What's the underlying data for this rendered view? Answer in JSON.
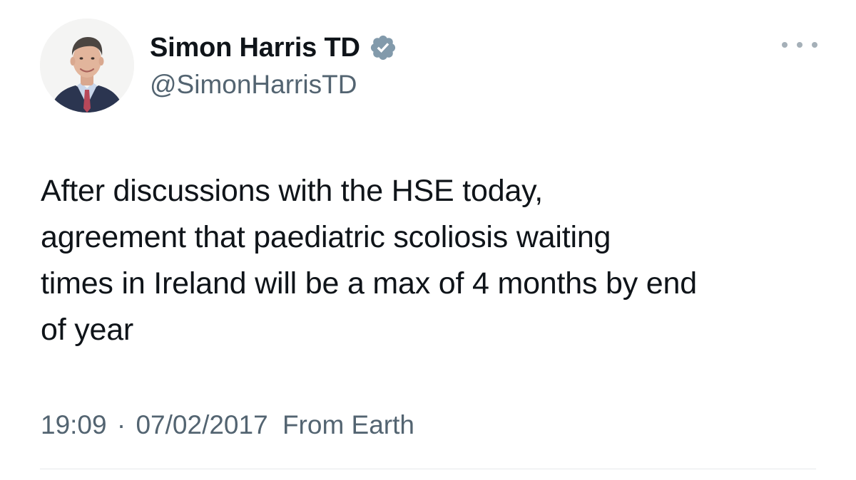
{
  "tweet": {
    "author": {
      "display_name": "Simon Harris TD",
      "handle": "@SimonHarrisTD",
      "verified": true,
      "avatar_icon": "profile-photo"
    },
    "text": "After discussions with the HSE today,\nagreement that paediatric scoliosis waiting\ntimes in Ireland will be a max of 4 months by end\nof year",
    "meta": {
      "time": "19:09",
      "separator": "·",
      "date": "07/02/2017",
      "source": "From Earth"
    },
    "more_icon": "more-horizontal-icon",
    "colors": {
      "text": "#0f1419",
      "secondary": "#536471",
      "verified_badge": "#829aab",
      "divider": "#e6e9eb"
    }
  }
}
